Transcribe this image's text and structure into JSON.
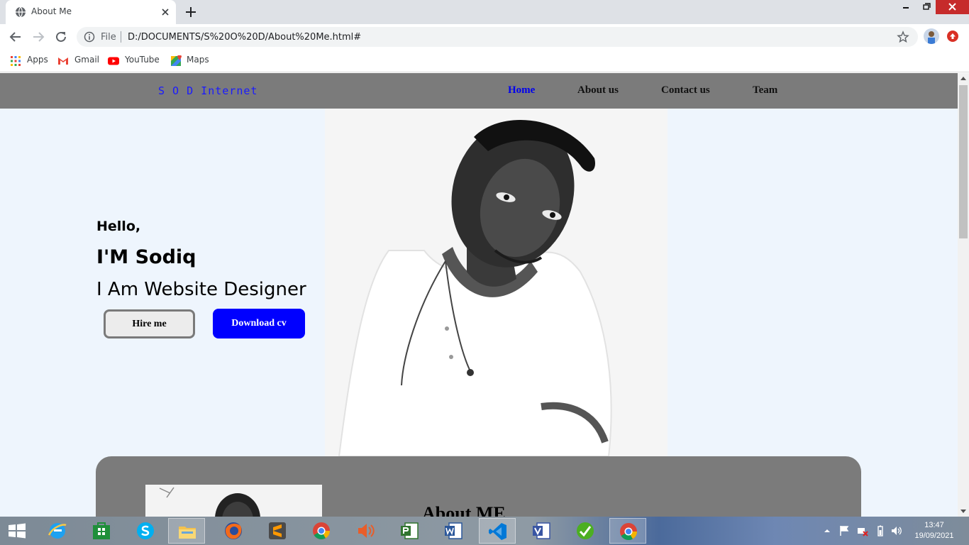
{
  "browser": {
    "tab": {
      "title": "About Me"
    },
    "omnibox": {
      "scheme_label": "File",
      "url": "D:/DOCUMENTS/S%20O%20D/About%20Me.html#"
    },
    "bookmarks": [
      {
        "label": "Apps",
        "icon": "apps-grid-icon"
      },
      {
        "label": "Gmail",
        "icon": "gmail-icon"
      },
      {
        "label": "YouTube",
        "icon": "youtube-icon"
      },
      {
        "label": "Maps",
        "icon": "maps-icon"
      }
    ]
  },
  "site": {
    "brand": "S O D Internet",
    "nav": [
      {
        "label": "Home",
        "active": true
      },
      {
        "label": "About us",
        "active": false
      },
      {
        "label": "Contact us",
        "active": false
      },
      {
        "label": "Team",
        "active": false
      }
    ],
    "hero": {
      "greeting": "Hello,",
      "name": "I'M Sodiq",
      "role": "I Am Website Designer",
      "hire_label": "Hire me",
      "cv_label": "Download cv",
      "photo": "portrait-photo"
    },
    "about": {
      "title": "About ME"
    }
  },
  "taskbar": {
    "apps": [
      "internet-explorer-icon",
      "store-icon",
      "skype-icon",
      "file-explorer-icon",
      "firefox-icon",
      "sublime-text-icon",
      "chrome-icon",
      "speaker-app-icon",
      "project-icon",
      "word-icon",
      "vscode-icon",
      "visio-icon",
      "green-app-icon",
      "chrome-active-icon"
    ],
    "clock": {
      "time": "13:47",
      "date": "19/09/2021"
    }
  },
  "colors": {
    "site_nav_bg": "#7b7b7b",
    "brand_blue": "#1a1aff",
    "accent_blue": "#0000ff",
    "page_bg": "#eef5fd",
    "close_red": "#c62b2b"
  }
}
